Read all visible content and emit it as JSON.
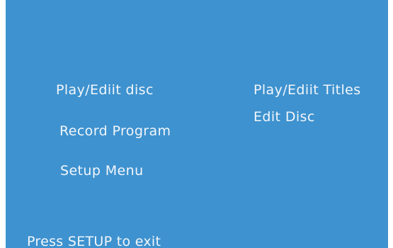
{
  "menu": {
    "left_items": [
      {
        "label": "Play/Ediit disc"
      },
      {
        "label": "Record  Program"
      },
      {
        "label": "Setup Menu"
      }
    ],
    "right_items": [
      {
        "label": "Play/Ediit Titles"
      },
      {
        "label": "Edit Disc"
      }
    ]
  },
  "footer": {
    "hint": "Press SETUP  to exit"
  },
  "colors": {
    "background": "#3e92cf",
    "text": "#f2f6fb"
  }
}
